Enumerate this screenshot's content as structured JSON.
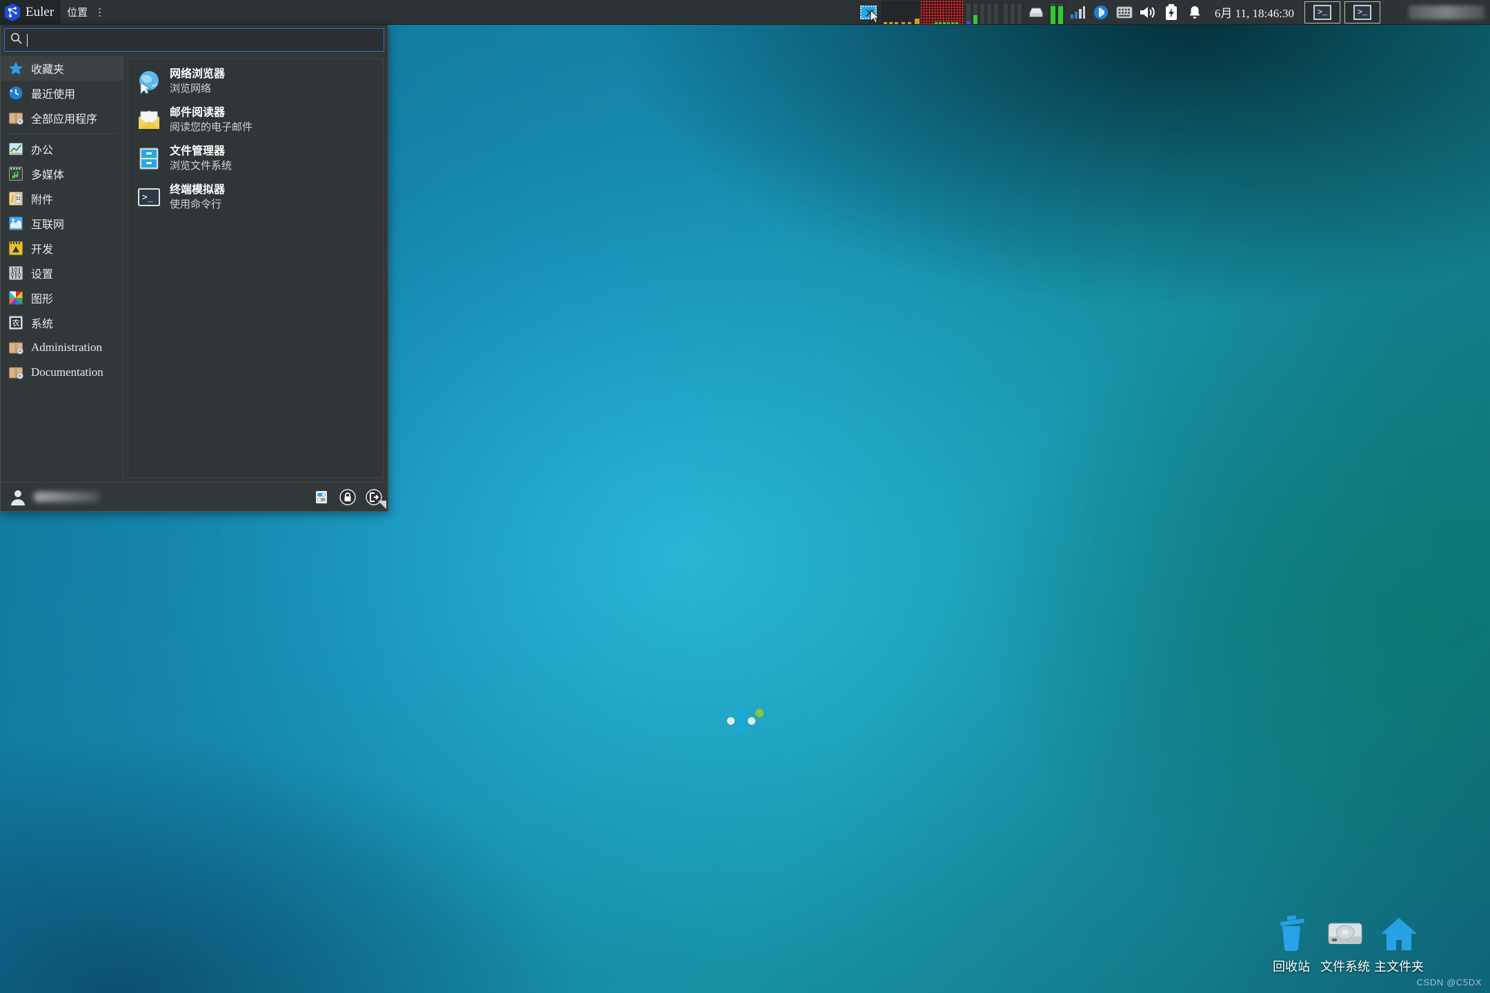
{
  "panel": {
    "menu_button_label": "Euler",
    "places_label": "位置",
    "clock": "6月 11, 18:46:30",
    "tray_icons": [
      "screenshot-icon",
      "cpu-graph-icon",
      "netload-graph-icon",
      "diskperf-graph-icon",
      "disk-icon",
      "memory-gauge-icon",
      "signal-icon",
      "bluetooth-icon",
      "keyboard-layout-icon",
      "volume-icon",
      "battery-icon",
      "notification-bell-icon"
    ],
    "tasks": [
      {
        "name": "终端模拟器",
        "glyph": ">_"
      },
      {
        "name": "终端模拟器",
        "glyph": ">_"
      }
    ]
  },
  "menu": {
    "search": {
      "value": "",
      "placeholder": ""
    },
    "categories": [
      {
        "label": "收藏夹",
        "icon": "star-icon",
        "selected": true
      },
      {
        "label": "最近使用",
        "icon": "recent-clock-icon",
        "selected": false
      },
      {
        "label": "全部应用程序",
        "icon": "package-icon",
        "selected": false
      },
      {
        "label": "办公",
        "icon": "office-chart-icon",
        "selected": false
      },
      {
        "label": "多媒体",
        "icon": "multimedia-icon",
        "selected": false
      },
      {
        "label": "附件",
        "icon": "accessories-icon",
        "selected": false
      },
      {
        "label": "互联网",
        "icon": "internet-globe-icon",
        "selected": false
      },
      {
        "label": "开发",
        "icon": "development-icon",
        "selected": false
      },
      {
        "label": "设置",
        "icon": "settings-sliders-icon",
        "selected": false
      },
      {
        "label": "图形",
        "icon": "graphics-icon",
        "selected": false
      },
      {
        "label": "系统",
        "icon": "system-icon",
        "selected": false
      },
      {
        "label": "Administration",
        "icon": "package-icon",
        "selected": false
      },
      {
        "label": "Documentation",
        "icon": "package-icon",
        "selected": false
      }
    ],
    "favorites": [
      {
        "name": "网络浏览器",
        "desc": "浏览网络",
        "icon": "web-browser-icon"
      },
      {
        "name": "邮件阅读器",
        "desc": "阅读您的电子邮件",
        "icon": "mail-reader-icon"
      },
      {
        "name": "文件管理器",
        "desc": "浏览文件系统",
        "icon": "file-manager-icon"
      },
      {
        "name": "终端模拟器",
        "desc": "使用命令行",
        "icon": "terminal-icon"
      }
    ],
    "footer": {
      "user_name": "",
      "buttons": [
        {
          "name": "settings-toggle-button",
          "icon": "toggle-switches-icon"
        },
        {
          "name": "lock-screen-button",
          "icon": "lock-icon"
        },
        {
          "name": "logout-button",
          "icon": "logout-icon"
        }
      ]
    }
  },
  "desktop": {
    "icons": [
      {
        "label": "回收站",
        "icon": "trash-icon"
      },
      {
        "label": "文件系统",
        "icon": "harddisk-icon"
      },
      {
        "label": "主文件夹",
        "icon": "home-folder-icon"
      }
    ],
    "watermark": "CSDN @C5DX"
  },
  "colors": {
    "panel_bg": "#2e3436",
    "menu_bg": "#32373a",
    "accent_blue": "#2f6fd0",
    "desktop_icon_blue": "#29a3e8",
    "wallpaper_center": "#1f86b4"
  }
}
